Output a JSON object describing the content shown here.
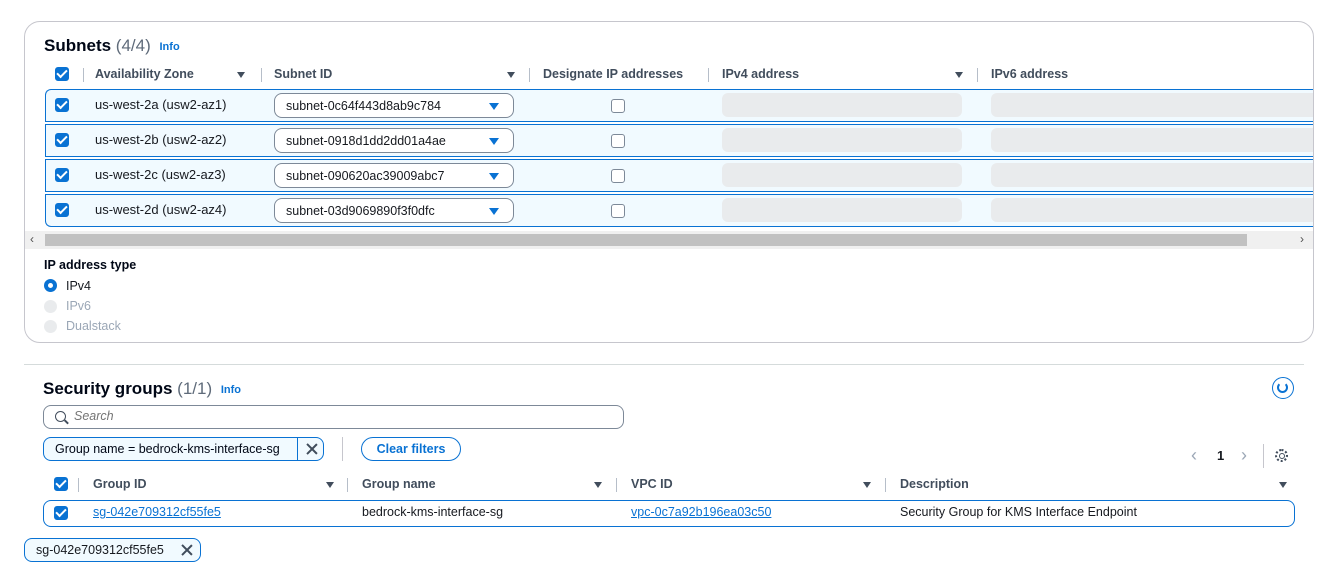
{
  "subnets": {
    "title": "Subnets",
    "count": "(4/4)",
    "info": "Info",
    "columns": [
      "Availability Zone",
      "Subnet ID",
      "Designate IP addresses",
      "IPv4 address",
      "IPv6 address"
    ],
    "rows": [
      {
        "az": "us-west-2a (usw2-az1)",
        "subnet": "subnet-0c64f443d8ab9c784",
        "checked": true,
        "designate": false
      },
      {
        "az": "us-west-2b (usw2-az2)",
        "subnet": "subnet-0918d1dd2dd01a4ae",
        "checked": true,
        "designate": false
      },
      {
        "az": "us-west-2c (usw2-az3)",
        "subnet": "subnet-090620ac39009abc7",
        "checked": true,
        "designate": false
      },
      {
        "az": "us-west-2d (usw2-az4)",
        "subnet": "subnet-03d9069890f3f0dfc",
        "checked": true,
        "designate": false
      }
    ]
  },
  "ip_address_type": {
    "label": "IP address type",
    "options": [
      {
        "label": "IPv4",
        "selected": true,
        "disabled": false
      },
      {
        "label": "IPv6",
        "selected": false,
        "disabled": true
      },
      {
        "label": "Dualstack",
        "selected": false,
        "disabled": true
      }
    ]
  },
  "security_groups": {
    "title": "Security groups",
    "count": "(1/1)",
    "info": "Info",
    "search_placeholder": "Search",
    "filter_token": "Group name = bedrock-kms-interface-sg",
    "clear_filters": "Clear filters",
    "page": "1",
    "columns": [
      "Group ID",
      "Group name",
      "VPC ID",
      "Description"
    ],
    "rows": [
      {
        "group_id": "sg-042e709312cf55fe5",
        "group_name": "bedrock-kms-interface-sg",
        "vpc_id": "vpc-0c7a92b196ea03c50",
        "description": "Security Group for KMS Interface Endpoint",
        "checked": true
      }
    ]
  },
  "selected_chip": "sg-042e709312cf55fe5",
  "colors": {
    "accent": "#0972d3",
    "row_bg": "#f1faff",
    "disabled": "#9ba7b6"
  }
}
